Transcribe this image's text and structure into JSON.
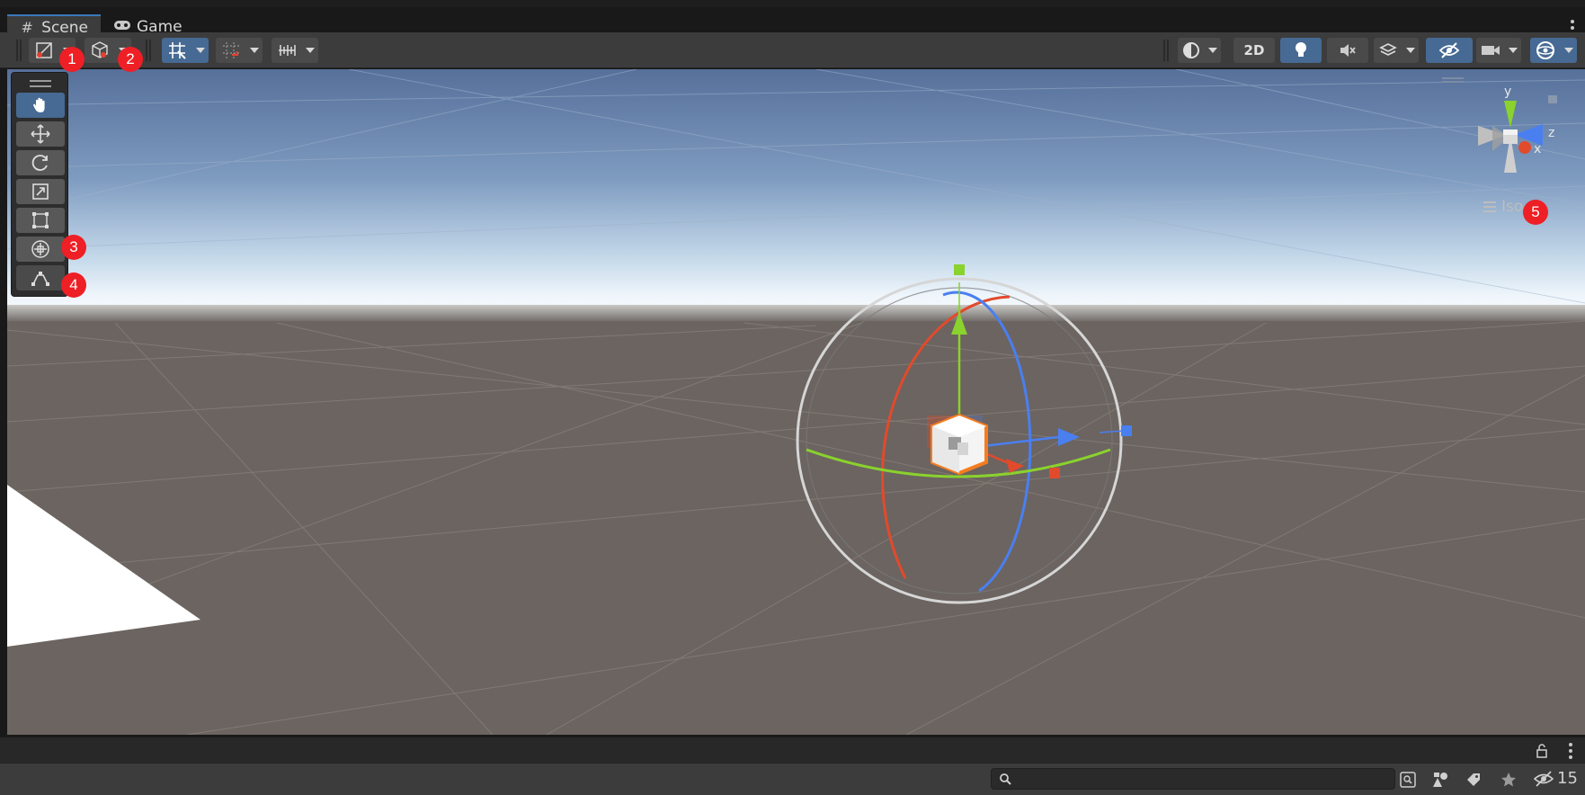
{
  "tabs": [
    {
      "label": "Scene",
      "icon": "grid-icon",
      "active": true
    },
    {
      "label": "Game",
      "icon": "gamepad-icon",
      "active": false
    }
  ],
  "toolbar": {
    "toggle_2d_label": "2D"
  },
  "badges": [
    "1",
    "2",
    "3",
    "4",
    "5"
  ],
  "gizmo": {
    "axis_y": "y",
    "axis_z": "z",
    "axis_x": "x",
    "projection_label": "Iso"
  },
  "bottom": {
    "search_value": "",
    "hidden_count": "15"
  },
  "colors": {
    "accent_active": "#466a93",
    "badge": "#ee1f25",
    "axis_x": "#e8402e",
    "axis_y": "#8fd42c",
    "axis_z": "#3d7af0",
    "selection_outline": "#f57c1f"
  }
}
